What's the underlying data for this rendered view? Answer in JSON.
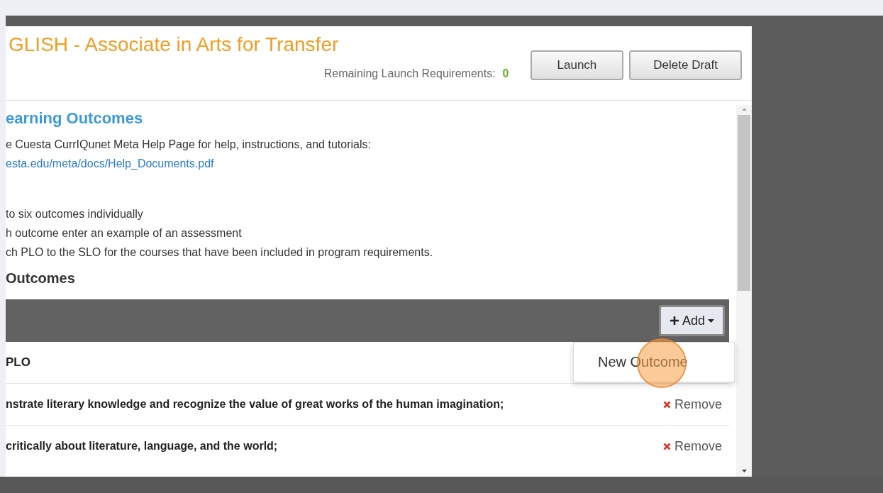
{
  "header": {
    "title": "GLISH - Associate in Arts for Transfer",
    "remaining_label": "Remaining Launch Requirements:",
    "remaining_count": "0",
    "buttons": [
      "Launch",
      "Delete Draft"
    ]
  },
  "section": {
    "heading": "earning Outcomes",
    "help_text": "e Cuesta CurrIQunet Meta Help Page for help, instructions, and tutorials:",
    "help_link": "esta.edu/meta/docs/Help_Documents.pdf",
    "instructions": [
      "to six outcomes individually",
      "h outcome enter an example of an assessment",
      "ch PLO to the SLO for the courses that have been included in program requirements."
    ],
    "subheading": "Outcomes"
  },
  "outcomes_table": {
    "add_button": "Add",
    "menu": [
      {
        "label": "New Outcome"
      }
    ],
    "column": "PLO",
    "rows": [
      {
        "text": "nstrate literary knowledge and recognize the value of great works of the human imagination;",
        "action": "Remove"
      },
      {
        "text": "critically about literature, language, and the world;",
        "action": "Remove"
      }
    ]
  }
}
